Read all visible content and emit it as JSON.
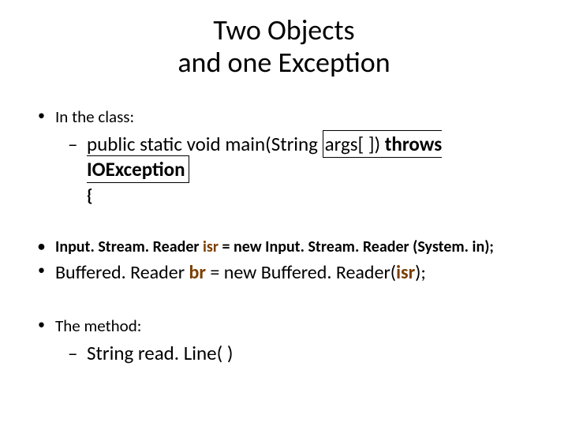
{
  "title_line1": "Two Objects",
  "title_line2": "and one Exception",
  "bullets": {
    "in_class": "In the class:",
    "main_sig": {
      "prefix": "public static void main(String ",
      "boxed": "args[ ]) ",
      "throws": "throws IOException",
      "brace": "{"
    },
    "isr": {
      "p1": "Input. Stream. Reader ",
      "var": "isr",
      "p2": " = new Input. Stream. Reader (System. in);"
    },
    "br": {
      "p1": "Buffered. Reader ",
      "var": "br",
      "p2": " = new Buffered. Reader(",
      "arg": "isr",
      "p3": ");"
    },
    "method": "The method:",
    "readline": "String read. Line(  )"
  }
}
